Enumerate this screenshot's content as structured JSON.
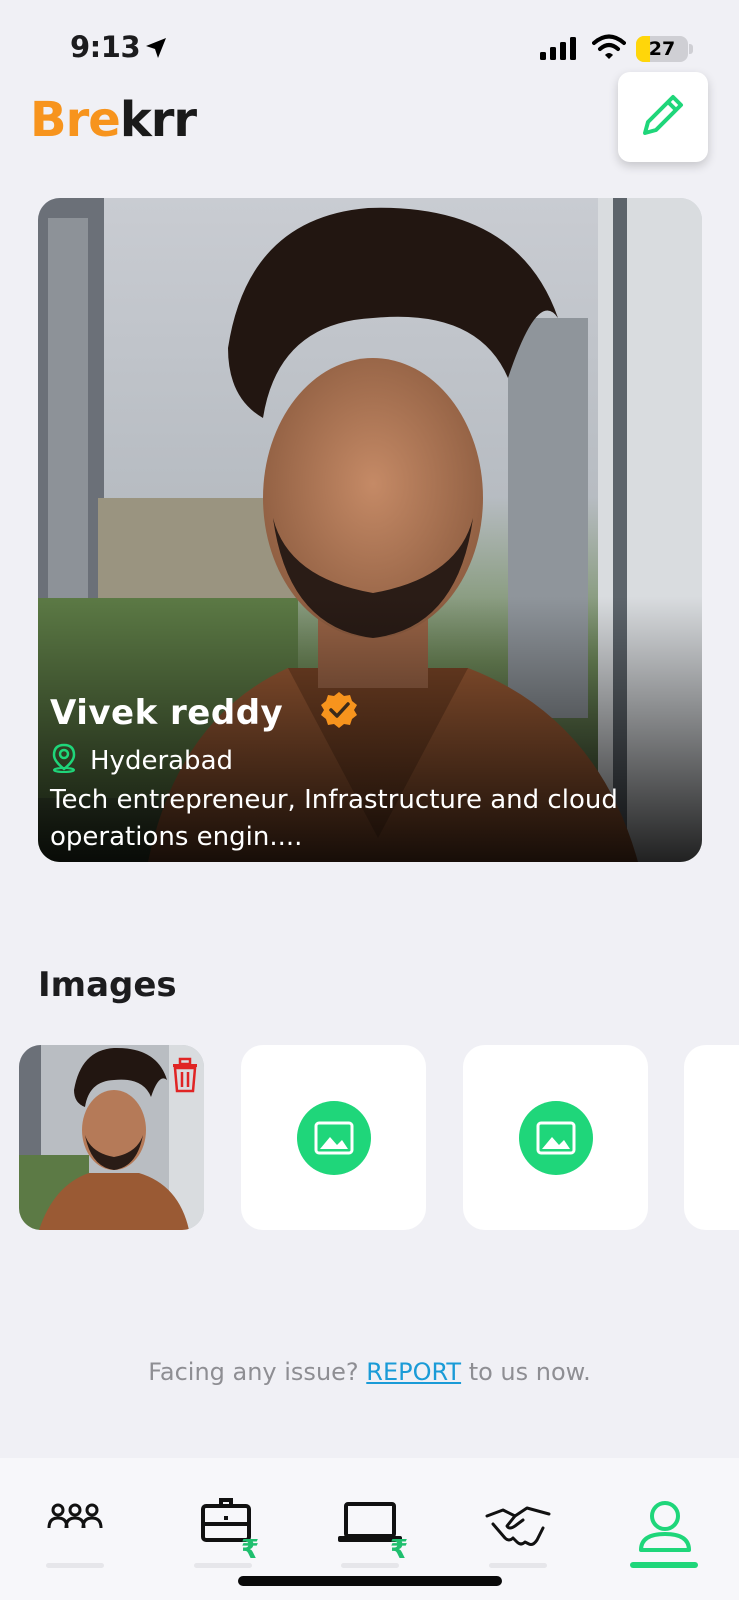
{
  "status_bar": {
    "time": "9:13",
    "battery": "27",
    "battery_level": 0.27
  },
  "header": {
    "logo_part_a": "Bre",
    "logo_part_b": "krr",
    "edit_icon": "pencil-icon"
  },
  "profile": {
    "name": "Vivek  reddy",
    "verified": true,
    "location": "Hyderabad",
    "bio_line_1": "Tech entrepreneur, Infrastructure and cloud",
    "bio_line_2": "operations engin...."
  },
  "images_section": {
    "title": "Images",
    "tiles": [
      {
        "type": "photo",
        "action_icon": "trash-icon"
      },
      {
        "type": "empty",
        "action_icon": "add-image-icon"
      },
      {
        "type": "empty",
        "action_icon": "add-image-icon"
      },
      {
        "type": "empty",
        "action_icon": "add-image-icon"
      }
    ]
  },
  "report": {
    "prefix": "Facing any issue? ",
    "link": "REPORT",
    "suffix": " to us now."
  },
  "bottom_nav": {
    "items": [
      {
        "icon": "people-icon",
        "active": false
      },
      {
        "icon": "briefcase-rupee-icon",
        "active": false
      },
      {
        "icon": "laptop-rupee-icon",
        "active": false
      },
      {
        "icon": "handshake-icon",
        "active": false
      },
      {
        "icon": "profile-icon",
        "active": true
      }
    ]
  },
  "colors": {
    "accent_green": "#1fd67a",
    "logo_orange": "#f7941d",
    "verified_orange": "#f7941d",
    "link_blue": "#1a9bd7",
    "delete_red": "#e02424"
  }
}
